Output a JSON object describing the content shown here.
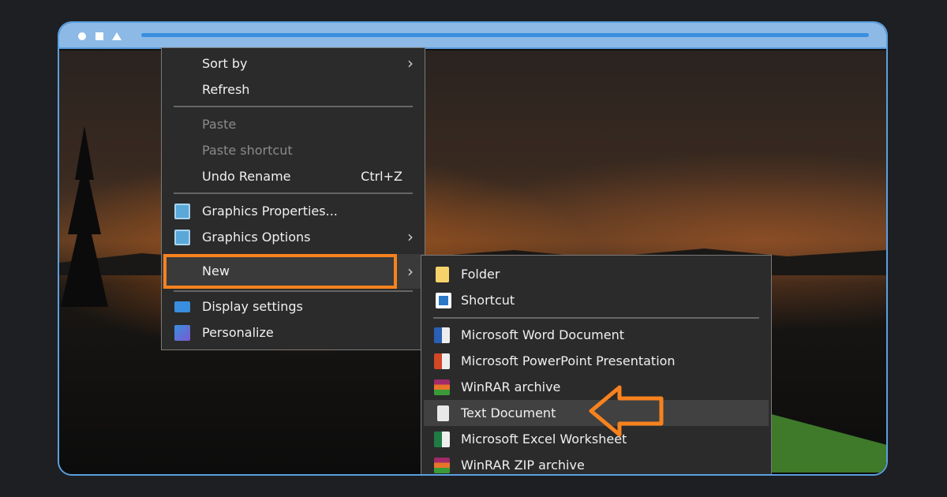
{
  "window": {
    "controls": [
      "circle",
      "square",
      "triangle"
    ],
    "accent": "#5a9fe0"
  },
  "context_menu": {
    "items": [
      {
        "label": "Sort by",
        "submenu": true
      },
      {
        "label": "Refresh"
      },
      {
        "label": "Paste",
        "disabled": true
      },
      {
        "label": "Paste shortcut",
        "disabled": true
      },
      {
        "label": "Undo Rename",
        "shortcut": "Ctrl+Z"
      },
      {
        "label": "Graphics Properties...",
        "icon": "graphics-icon"
      },
      {
        "label": "Graphics Options",
        "icon": "graphics-icon",
        "submenu": true
      },
      {
        "label": "New",
        "submenu": true,
        "highlighted": true
      },
      {
        "label": "Display settings",
        "icon": "display-icon"
      },
      {
        "label": "Personalize",
        "icon": "personalize-icon"
      }
    ]
  },
  "new_submenu": {
    "items": [
      {
        "label": "Folder",
        "icon": "folder-icon"
      },
      {
        "label": "Shortcut",
        "icon": "shortcut-icon"
      },
      {
        "label": "Microsoft Word Document",
        "icon": "word-icon"
      },
      {
        "label": "Microsoft PowerPoint Presentation",
        "icon": "powerpoint-icon"
      },
      {
        "label": "WinRAR archive",
        "icon": "winrar-icon"
      },
      {
        "label": "Text Document",
        "icon": "text-document-icon",
        "hovered": true
      },
      {
        "label": "Microsoft Excel Worksheet",
        "icon": "excel-icon"
      },
      {
        "label": "WinRAR ZIP archive",
        "icon": "winrar-icon"
      }
    ]
  },
  "annotation": {
    "highlight_color": "#f7821e"
  }
}
